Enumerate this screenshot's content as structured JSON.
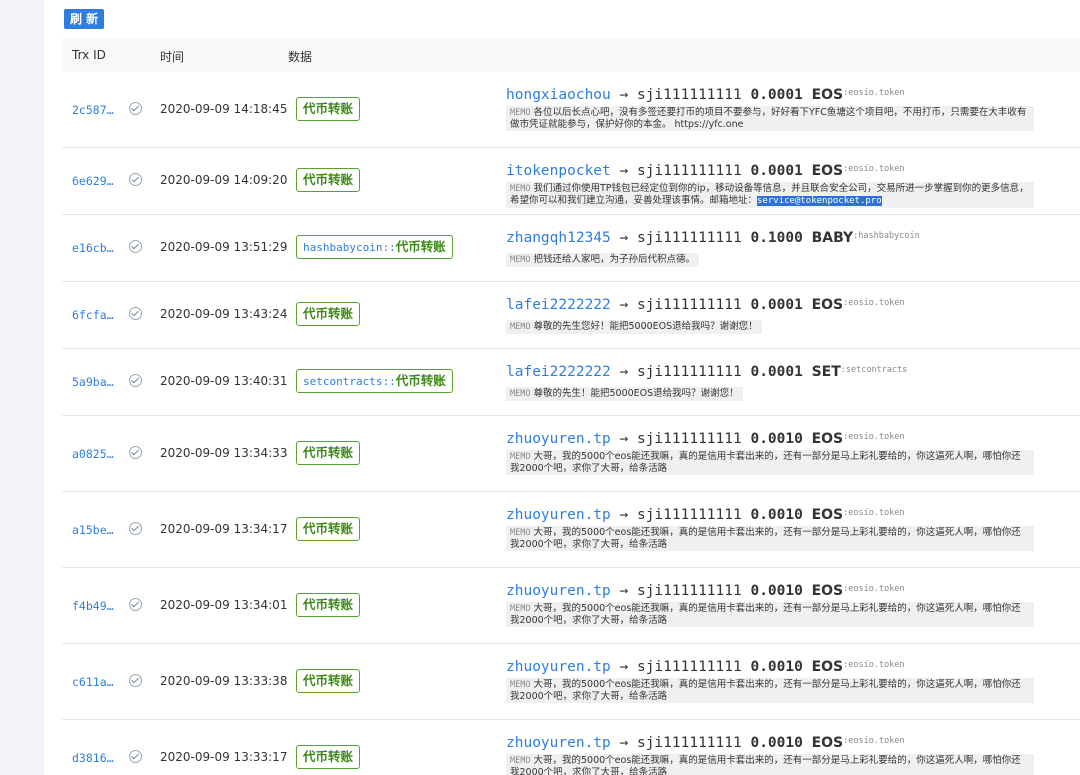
{
  "toolbar": {
    "refresh_label": "刷 新"
  },
  "table": {
    "headers": {
      "trx_id": "Trx ID",
      "time": "时间",
      "data": "数据"
    },
    "memo_label": "MEMO",
    "arrow": "→",
    "rows": [
      {
        "trx": "2c587…",
        "time": "2020-09-09 14:18:45",
        "contract": "",
        "action": "代币转账",
        "from": "hongxiaochou",
        "to": "sji111111111",
        "amount": "0.0001",
        "symbol": "EOS",
        "token_contract": ":eosio.token",
        "memo": "各位以后长点心吧，没有多签还要打币的项目不要参与，好好看下YFC鱼塘这个项目吧，不用打币，只需要在大丰收有做市凭证就能参与，保护好你的本金。 https://yfc.one",
        "email": ""
      },
      {
        "trx": "6e629…",
        "time": "2020-09-09 14:09:20",
        "contract": "",
        "action": "代币转账",
        "from": "itokenpocket",
        "to": "sji111111111",
        "amount": "0.0001",
        "symbol": "EOS",
        "token_contract": ":eosio.token",
        "memo": "我们通过你使用TP钱包已经定位到你的ip，移动设备等信息，并且联合安全公司，交易所进一步掌握到你的更多信息，希望你可以和我们建立沟通，妥善处理该事情。邮箱地址：",
        "email": "service@tokenpocket.pro"
      },
      {
        "trx": "e16cb…",
        "time": "2020-09-09 13:51:29",
        "contract": "hashbabycoin::",
        "action": "代币转账",
        "from": "zhangqh12345",
        "to": "sji111111111",
        "amount": "0.1000",
        "symbol": "BABY",
        "token_contract": ":hashbabycoin",
        "memo": "把钱还给人家吧，为子孙后代积点德。",
        "email": ""
      },
      {
        "trx": "6fcfa…",
        "time": "2020-09-09 13:43:24",
        "contract": "",
        "action": "代币转账",
        "from": "lafei2222222",
        "to": "sji111111111",
        "amount": "0.0001",
        "symbol": "EOS",
        "token_contract": ":eosio.token",
        "memo": "尊敬的先生您好！能把5000EOS退给我吗？谢谢您！",
        "email": ""
      },
      {
        "trx": "5a9ba…",
        "time": "2020-09-09 13:40:31",
        "contract": "setcontracts::",
        "action": "代币转账",
        "from": "lafei2222222",
        "to": "sji111111111",
        "amount": "0.0001",
        "symbol": "SET",
        "token_contract": ":setcontracts",
        "memo": "尊敬的先生！能把5000EOS退给我吗？谢谢您！",
        "email": ""
      },
      {
        "trx": "a0825…",
        "time": "2020-09-09 13:34:33",
        "contract": "",
        "action": "代币转账",
        "from": "zhuoyuren.tp",
        "to": "sji111111111",
        "amount": "0.0010",
        "symbol": "EOS",
        "token_contract": ":eosio.token",
        "memo": "大哥，我的5000个eos能还我嘛，真的是信用卡套出来的，还有一部分是马上彩礼要给的，你这逼死人啊，哪怕你还我2000个吧，求你了大哥，给条活路",
        "email": ""
      },
      {
        "trx": "a15be…",
        "time": "2020-09-09 13:34:17",
        "contract": "",
        "action": "代币转账",
        "from": "zhuoyuren.tp",
        "to": "sji111111111",
        "amount": "0.0010",
        "symbol": "EOS",
        "token_contract": ":eosio.token",
        "memo": "大哥，我的5000个eos能还我嘛，真的是信用卡套出来的，还有一部分是马上彩礼要给的，你这逼死人啊，哪怕你还我2000个吧，求你了大哥，给条活路",
        "email": ""
      },
      {
        "trx": "f4b49…",
        "time": "2020-09-09 13:34:01",
        "contract": "",
        "action": "代币转账",
        "from": "zhuoyuren.tp",
        "to": "sji111111111",
        "amount": "0.0010",
        "symbol": "EOS",
        "token_contract": ":eosio.token",
        "memo": "大哥，我的5000个eos能还我嘛，真的是信用卡套出来的，还有一部分是马上彩礼要给的，你这逼死人啊，哪怕你还我2000个吧，求你了大哥，给条活路",
        "email": ""
      },
      {
        "trx": "c611a…",
        "time": "2020-09-09 13:33:38",
        "contract": "",
        "action": "代币转账",
        "from": "zhuoyuren.tp",
        "to": "sji111111111",
        "amount": "0.0010",
        "symbol": "EOS",
        "token_contract": ":eosio.token",
        "memo": "大哥，我的5000个eos能还我嘛，真的是信用卡套出来的，还有一部分是马上彩礼要给的，你这逼死人啊，哪怕你还我2000个吧，求你了大哥，给条活路",
        "email": ""
      },
      {
        "trx": "d3816…",
        "time": "2020-09-09 13:33:17",
        "contract": "",
        "action": "代币转账",
        "from": "zhuoyuren.tp",
        "to": "sji111111111",
        "amount": "0.0010",
        "symbol": "EOS",
        "token_contract": ":eosio.token",
        "memo": "大哥，我的5000个eos能还我嘛，真的是信用卡套出来的，还有一部分是马上彩礼要给的，你这逼死人啊，哪怕你还我2000个吧，求你了大哥，给条活路",
        "email": ""
      }
    ]
  }
}
